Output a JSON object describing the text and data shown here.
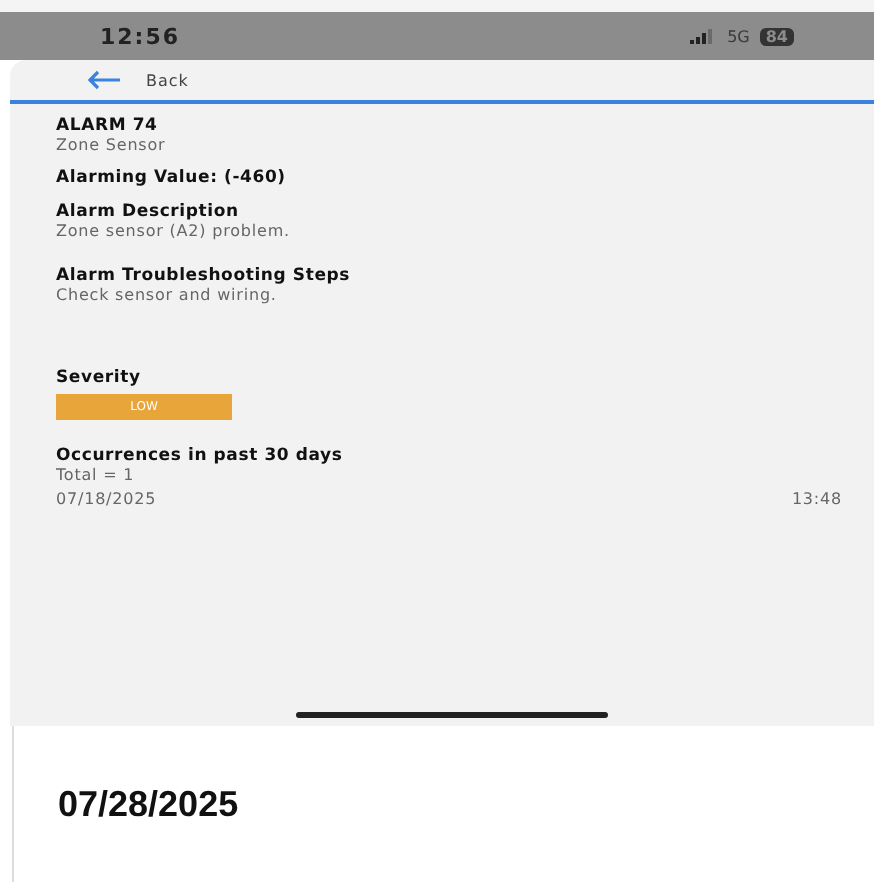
{
  "status_bar": {
    "time": "12:56",
    "network": "5G",
    "battery": "84"
  },
  "nav": {
    "back_label": "Back"
  },
  "alarm": {
    "title": "ALARM 74",
    "subtitle": "Zone Sensor",
    "alarming_value": "Alarming Value: (-460)"
  },
  "sections": [
    {
      "heading": "Alarm Description",
      "text": "Zone sensor (A2) problem."
    },
    {
      "heading": "Alarm Troubleshooting Steps",
      "text": "Check sensor and wiring."
    }
  ],
  "severity": {
    "heading": "Severity",
    "label": "LOW",
    "color": "#e8a63a"
  },
  "occurrences": {
    "heading": "Occurrences in past 30 days",
    "total": "Total = 1",
    "rows": [
      {
        "date": "07/18/2025",
        "time": "13:48"
      }
    ]
  },
  "footer_date": "07/28/2025"
}
